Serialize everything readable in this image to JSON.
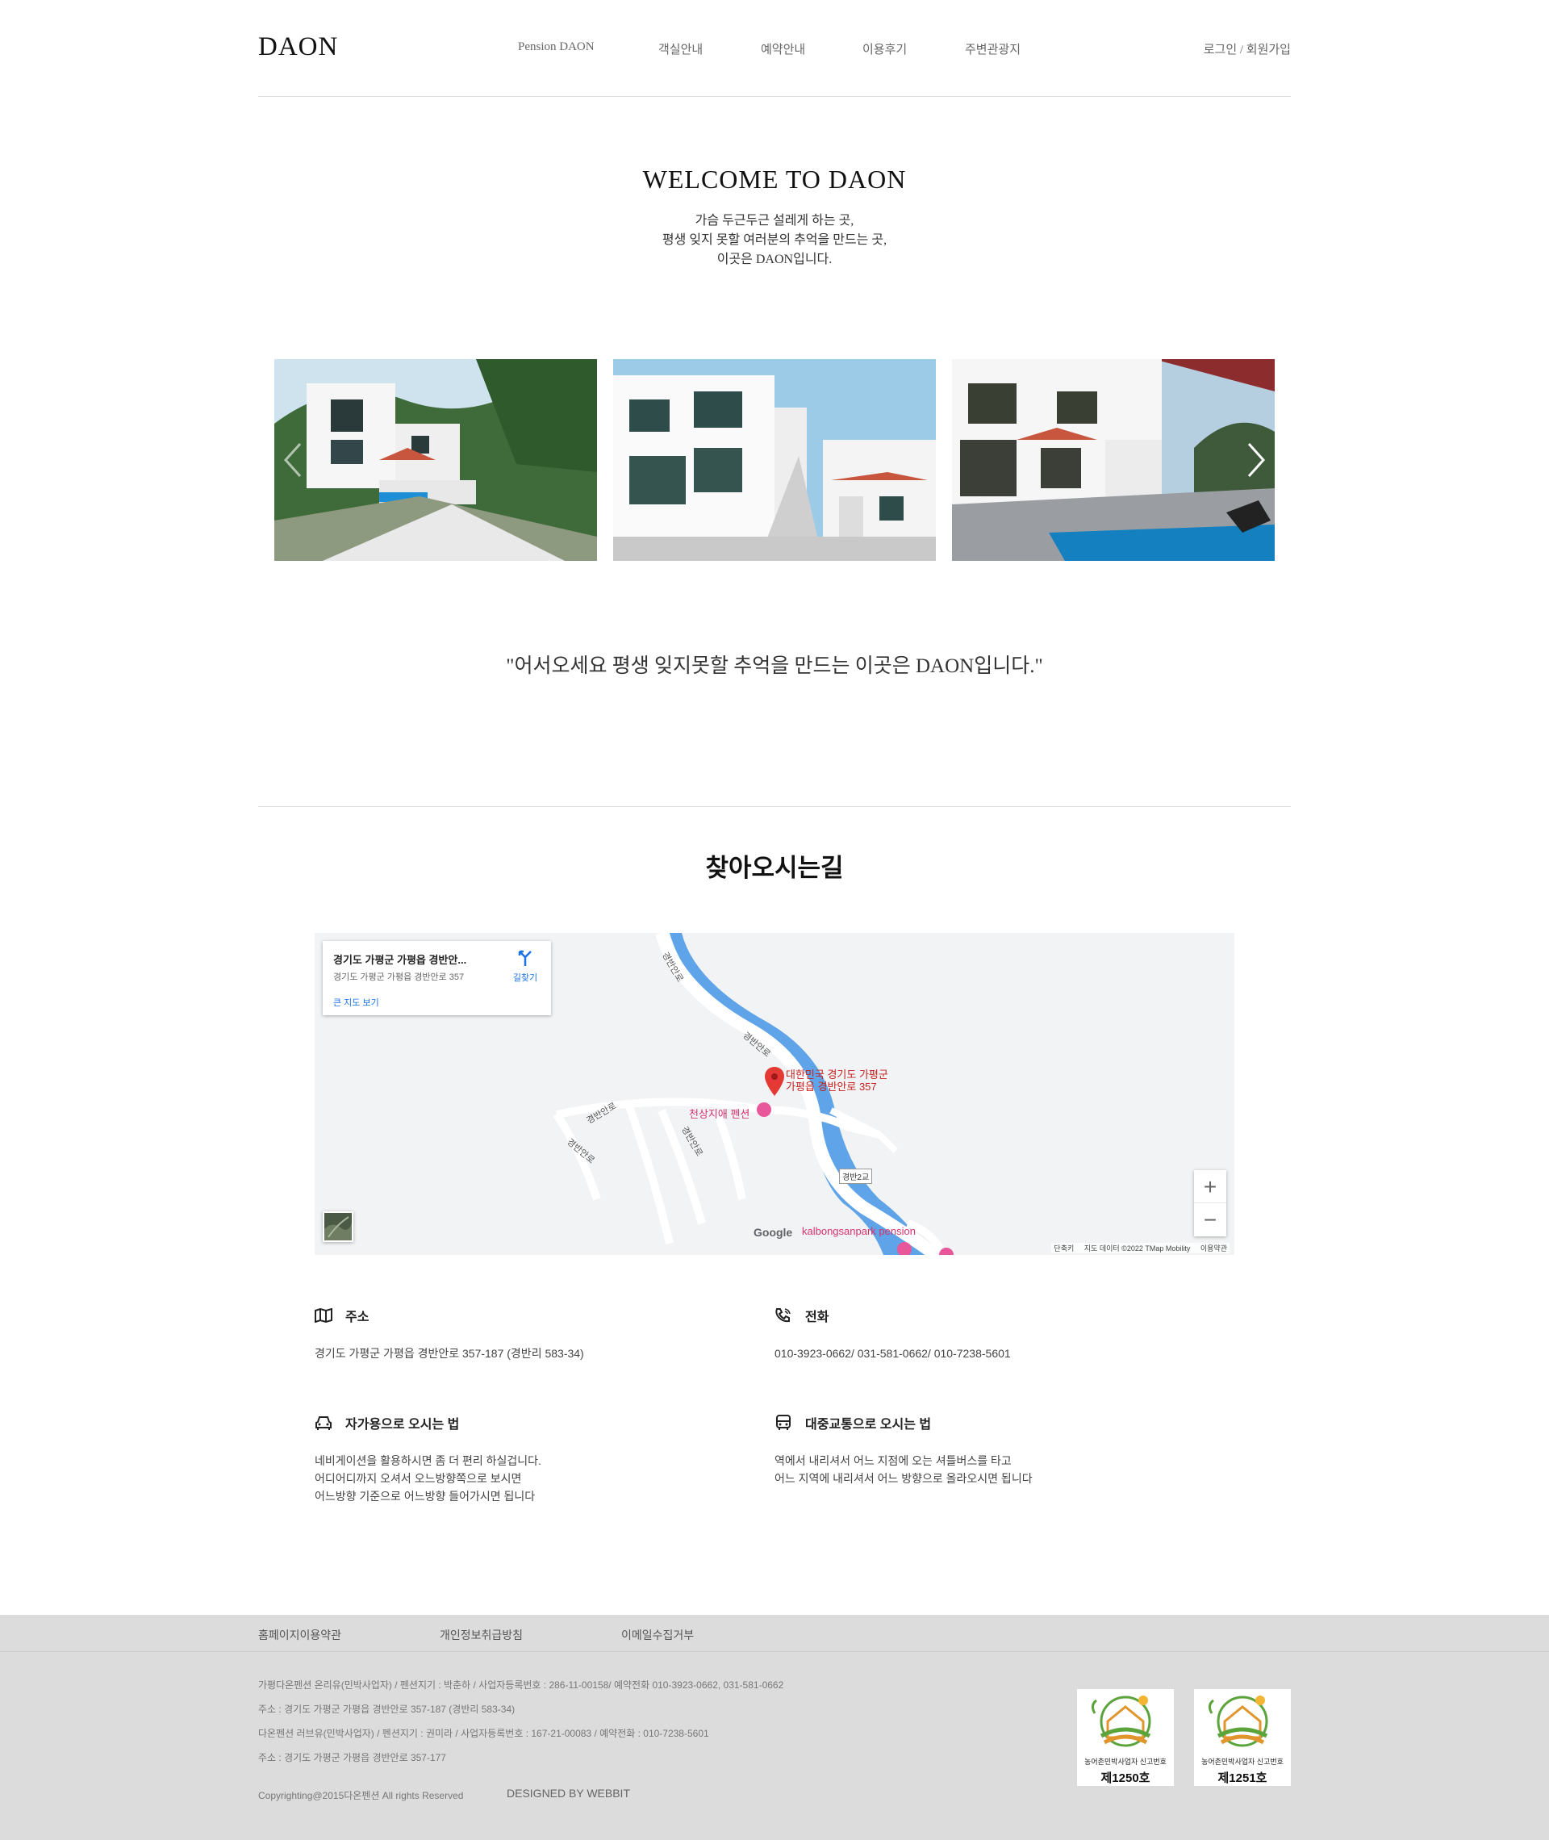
{
  "header": {
    "logo": "DAON",
    "nav": [
      "Pension DAON",
      "객실안내",
      "예약안내",
      "이용후기",
      "주변관광지"
    ],
    "auth": "로그인 / 회원가입"
  },
  "welcome": {
    "title": "WELCOME TO DAON",
    "lines": [
      "가슴 두근두근 설레게 하는 곳,",
      "평생 잊지 못할 여러분의 추억을 만드는 곳,",
      "이곳은 DAON입니다."
    ]
  },
  "gallery": {
    "photos": [
      "pension-exterior-hillside",
      "pension-building-stairs",
      "pension-pool-terrace"
    ]
  },
  "quote": "\"어서오세요 평생 잊지못할 추억을 만드는 이곳은 DAON입니다.\"",
  "directions": {
    "title": "찾아오시는길"
  },
  "map": {
    "card_title": "경기도 가평군 가평읍 경반안...",
    "card_address": "경기도 가평군 가평읍 경반안로 357",
    "directions_label": "길찾기",
    "larger_map_label": "큰 지도 보기",
    "pin_label_1": "대한민국 경기도 가평군",
    "pin_label_2": "가평읍 경반안로 357",
    "poi_1": "천상지애 펜션",
    "poi_2": "kalbongsanpark pension",
    "road_labels": [
      "경반안로",
      "경반안로",
      "경반안로",
      "경반안로",
      "경반안로"
    ],
    "bridge_label": "경반2교",
    "google_logo": "Google",
    "attribution": [
      "단축키",
      "지도 데이터 ©2022 TMap Mobility",
      "이용약관"
    ],
    "zoom_in": "+",
    "zoom_out": "−"
  },
  "info": {
    "address": {
      "title": "주소",
      "lines": [
        "경기도 가평군 가평읍 경반안로 357-187 (경반리 583-34)"
      ]
    },
    "phone": {
      "title": "전화",
      "lines": [
        "010-3923-0662/ 031-581-0662/ 010-7238-5601"
      ]
    },
    "car": {
      "title": "자가용으로 오시는 법",
      "lines": [
        "네비게이션을 활용하시면 좀 더 편리 하실겁니다.",
        "어디어디까지 오셔서 오느방향쪽으로 보시면",
        "어느방향 기준으로 어느방향 들어가시면 됩니다"
      ]
    },
    "bus": {
      "title": "대중교통으로 오시는 법",
      "lines": [
        "역에서 내리셔서 어느 지점에 오는 셔틀버스를 타고",
        "어느 지역에 내리셔서 어느 방향으로 올라오시면 됩니다"
      ]
    }
  },
  "footer": {
    "links": [
      "홈페이지이용약관",
      "개인정보취급방침",
      "이메일수집거부"
    ],
    "lines": [
      "가평다온펜션 온리유(민박사업자) / 펜션지기 : 박춘하 / 사업자등록번호 : 286-11-00158/ 예약전화 010-3923-0662, 031-581-0662",
      "주소 : 경기도 가평군 가평읍 경반안로 357-187 (경반리 583-34)",
      "다온펜션 러브유(민박사업자) / 펜션지기 : 권미라 / 사업자등록번호 : 167-21-00083 / 예약전화 : 010-7238-5601",
      "주소 : 경기도 가평군 가평읍 경반안로 357-177"
    ],
    "copyright": "Copyrighting@2015다온펜션 All rights Reserved",
    "designed_by": "DESIGNED BY WEBBIT",
    "badges": [
      {
        "caption": "농어촌민박사업자 신고번호",
        "number": "제1250호"
      },
      {
        "caption": "농어촌민박사업자 신고번호",
        "number": "제1251호"
      }
    ]
  }
}
